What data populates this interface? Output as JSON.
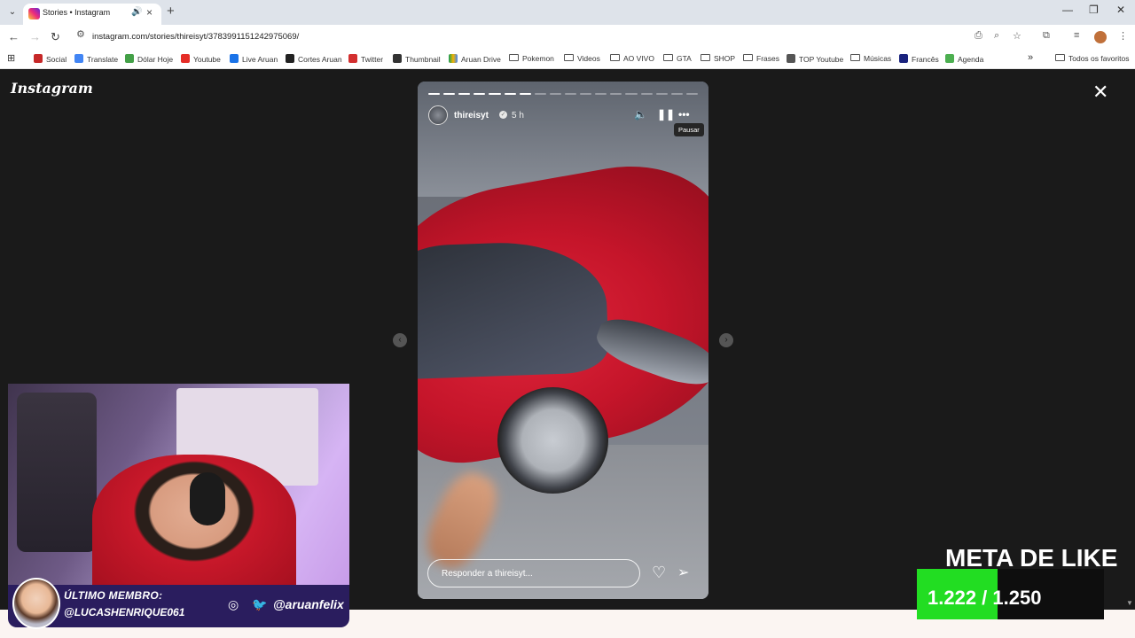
{
  "browser": {
    "tab_title": "Stories • Instagram",
    "url": "instagram.com/stories/thireisyt/3783991151242975069/",
    "bookmarks": [
      "Social",
      "Translate",
      "Dólar Hoje",
      "Youtube",
      "Live Aruan",
      "Cortes Aruan",
      "Twitter",
      "Thumbnail",
      "Aruan Drive",
      "Pokemon",
      "Videos",
      "AO VIVO",
      "GTA",
      "SHOP",
      "Frases",
      "TOP Youtube",
      "Músicas",
      "Francês",
      "Agenda"
    ],
    "all_bookmarks": "Todos os favoritos"
  },
  "instagram": {
    "logo": "Instagram",
    "story": {
      "username": "thireisyt",
      "time": "5 h",
      "pause_tooltip": "Pausar",
      "reply_placeholder": "Responder a thireisyt...",
      "segments_total": 18,
      "segments_done": 7
    }
  },
  "stream_overlay": {
    "member_label": "ÚLTIMO MEMBRO:",
    "member_name": "@LUCASHENRIQUE061",
    "handle": "@aruanfelix",
    "like_goal_label": "META DE LIKE",
    "like_goal_count": "1.222 / 1.250",
    "like_goal_progress": 0.43
  },
  "colors": {
    "goal_fill": "#22dd22",
    "overlay_bar": "#2a1d5e",
    "page_bg": "#1a1a1a"
  }
}
